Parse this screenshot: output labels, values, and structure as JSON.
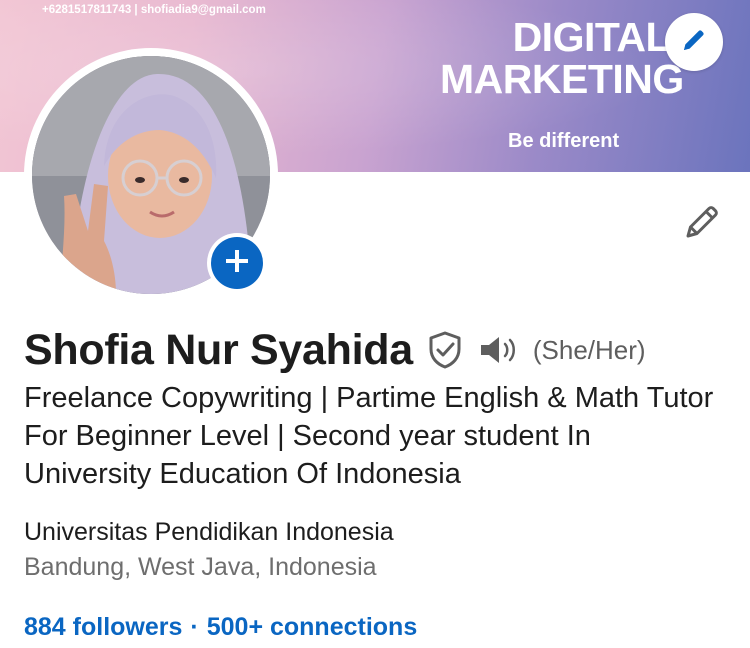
{
  "banner": {
    "contact": "+6281517811743 | shofiadia9@gmail.com",
    "title_line1": "DIGITAL",
    "title_line2": "MARKETING",
    "tagline": "Be different",
    "edit_icon": "pencil-icon"
  },
  "profile": {
    "add_photo_icon": "plus-icon",
    "edit_intro_icon": "pencil-icon",
    "name": "Shofia Nur Syahida",
    "verification_icon": "shield-check-icon",
    "pronunciation_icon": "speaker-icon",
    "pronouns": "(She/Her)",
    "headline": "Freelance Copywriting | Partime English & Math Tutor For Beginner Level | Second year student In University Education Of Indonesia",
    "education": "Universitas Pendidikan Indonesia",
    "location": "Bandung, West Java, Indonesia",
    "followers": "884 followers",
    "separator": "·",
    "connections": "500+ connections"
  },
  "colors": {
    "accent": "#0a66c2",
    "text": "#1d1d1d",
    "muted": "#6e6e6e"
  }
}
